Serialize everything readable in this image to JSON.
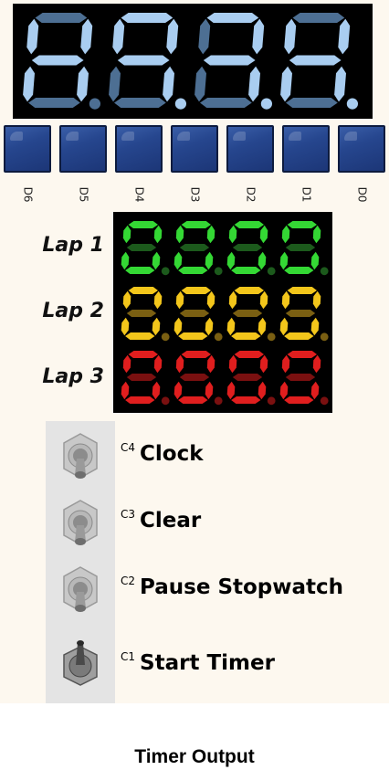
{
  "main_display": {
    "segment_on_color": "#a9cdf0",
    "segment_off_color": "#4d6f93",
    "digits": [
      {
        "on": [
          "b",
          "c",
          "e",
          "f",
          "g"
        ],
        "dp": false
      },
      {
        "on": [
          "a",
          "b",
          "c",
          "f",
          "g"
        ],
        "dp": true
      },
      {
        "on": [
          "a",
          "b",
          "c",
          "g"
        ],
        "dp": true
      },
      {
        "on": [
          "b",
          "c",
          "e",
          "f",
          "g"
        ],
        "dp": true
      }
    ]
  },
  "leds": [
    {
      "label": "D6",
      "on": false
    },
    {
      "label": "D5",
      "on": false
    },
    {
      "label": "D4",
      "on": false
    },
    {
      "label": "D3",
      "on": false
    },
    {
      "label": "D2",
      "on": false
    },
    {
      "label": "D1",
      "on": false
    },
    {
      "label": "D0",
      "on": false
    }
  ],
  "laps": [
    {
      "label": "Lap 1",
      "on_color": "#34d834",
      "off_color": "#1c5a1c",
      "digits_on": [
        [
          "a",
          "b",
          "c",
          "d",
          "e",
          "f"
        ],
        [
          "a",
          "b",
          "c",
          "d",
          "e",
          "f"
        ],
        [
          "a",
          "b",
          "c",
          "d",
          "e",
          "f"
        ],
        [
          "a",
          "b",
          "c",
          "d",
          "e",
          "f"
        ]
      ]
    },
    {
      "label": "Lap 2",
      "on_color": "#f3c61b",
      "off_color": "#7a5f12",
      "digits_on": [
        [
          "a",
          "b",
          "c",
          "d",
          "e",
          "f"
        ],
        [
          "a",
          "b",
          "c",
          "d",
          "e",
          "f"
        ],
        [
          "a",
          "b",
          "c",
          "d",
          "e",
          "f"
        ],
        [
          "a",
          "b",
          "c",
          "d",
          "e",
          "f"
        ]
      ]
    },
    {
      "label": "Lap 3",
      "on_color": "#e01e1e",
      "off_color": "#7a1010",
      "digits_on": [
        [
          "a",
          "b",
          "c",
          "d",
          "e",
          "f"
        ],
        [
          "a",
          "b",
          "c",
          "d",
          "e",
          "f"
        ],
        [
          "a",
          "b",
          "c",
          "d",
          "e",
          "f"
        ],
        [
          "a",
          "b",
          "c",
          "d",
          "e",
          "f"
        ]
      ]
    }
  ],
  "switches": [
    {
      "channel": "C4",
      "label": "Clock",
      "state": "off"
    },
    {
      "channel": "C3",
      "label": "Clear",
      "state": "off"
    },
    {
      "channel": "C2",
      "label": "Pause Stopwatch",
      "state": "off"
    },
    {
      "channel": "C1",
      "label": "Start Timer",
      "state": "on"
    }
  ],
  "footer_title": "Timer Output"
}
